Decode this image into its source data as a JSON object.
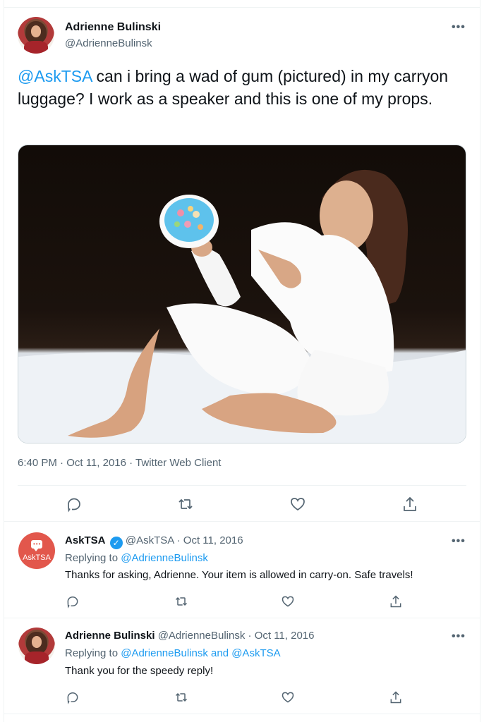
{
  "main_tweet": {
    "author_name": "Adrienne Bulinski",
    "author_handle": "@AdrienneBulinsk",
    "mention": "@AskTSA",
    "text": " can i bring a wad of gum (pictured) in my carryon luggage? I work as a speaker and this is one of my props.",
    "timestamp": "6:40 PM · Oct 11, 2016 · Twitter Web Client",
    "more_icon": "more-icon",
    "actions": [
      "reply-icon",
      "retweet-icon",
      "like-icon",
      "share-icon"
    ]
  },
  "replies": [
    {
      "author_name": "AskTSA",
      "verified": true,
      "author_handle": "@AskTSA",
      "separator": " · ",
      "date": "Oct 11, 2016",
      "replying_prefix": "Replying to ",
      "replying_to": "@AdrienneBulinsk",
      "text": "Thanks for asking, Adrienne. Your item is allowed in carry-on. Safe travels!",
      "avatar_label": "AskTSA"
    },
    {
      "author_name": "Adrienne Bulinski",
      "author_handle": "@AdrienneBulinsk",
      "separator": " · ",
      "date": "Oct 11, 2016",
      "replying_prefix": "Replying to ",
      "replying_to": "@AdrienneBulinsk and @AskTSA",
      "text": "Thank you for the speedy reply!"
    }
  ],
  "colors": {
    "link": "#1d9bf0",
    "muted": "#536471",
    "text": "#0f1419",
    "tsa_red": "#e2574c"
  }
}
